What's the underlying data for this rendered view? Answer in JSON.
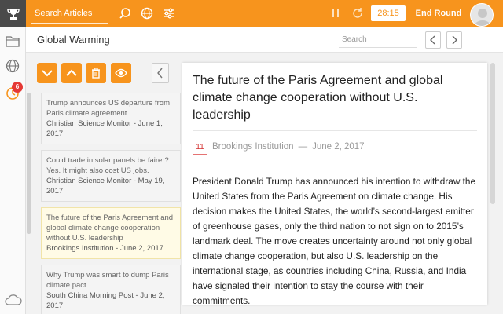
{
  "topbar": {
    "search_placeholder": "Search Articles",
    "timer": "28:15",
    "end_round": "End Round"
  },
  "header": {
    "title": "Global Warming",
    "search_placeholder": "Search"
  },
  "rail": {
    "badge_count": "6"
  },
  "articles": [
    {
      "title": "Trump announces US departure from Paris climate agreement",
      "source": "Christian Science Monitor - June 1, 2017"
    },
    {
      "title": "Could trade in solar panels be fairer? Yes. It might also cost US jobs.",
      "source": "Christian Science Monitor - May 19, 2017"
    },
    {
      "title": "The future of the Paris Agreement and global climate change cooperation without U.S. leadership",
      "source": "Brookings Institution - June 2, 2017"
    },
    {
      "title": "Why Trump was smart to dump Paris climate pact",
      "source": "South China Morning Post - June 2, 2017"
    }
  ],
  "article": {
    "title": "The future of the Paris Agreement and global climate change cooperation without U.S. leadership",
    "score": "11",
    "source": "Brookings Institution",
    "separator": "—",
    "date": "June 2, 2017",
    "body": "President Donald Trump has announced his intention to withdraw the United States from the Paris Agreement on climate change. His decision makes the United States, the world’s second-largest emitter of greenhouse gases, only the third nation to not sign on to 2015’s landmark deal. The move creates uncertainty around not only global climate change cooperation, but also U.S. leadership on the international stage, as countries including China, Russia, and India have signaled their intention to stay the course with their commitments."
  },
  "colors": {
    "accent": "#f7941d",
    "badge": "#e53935",
    "highlight": "#fffbe6"
  }
}
